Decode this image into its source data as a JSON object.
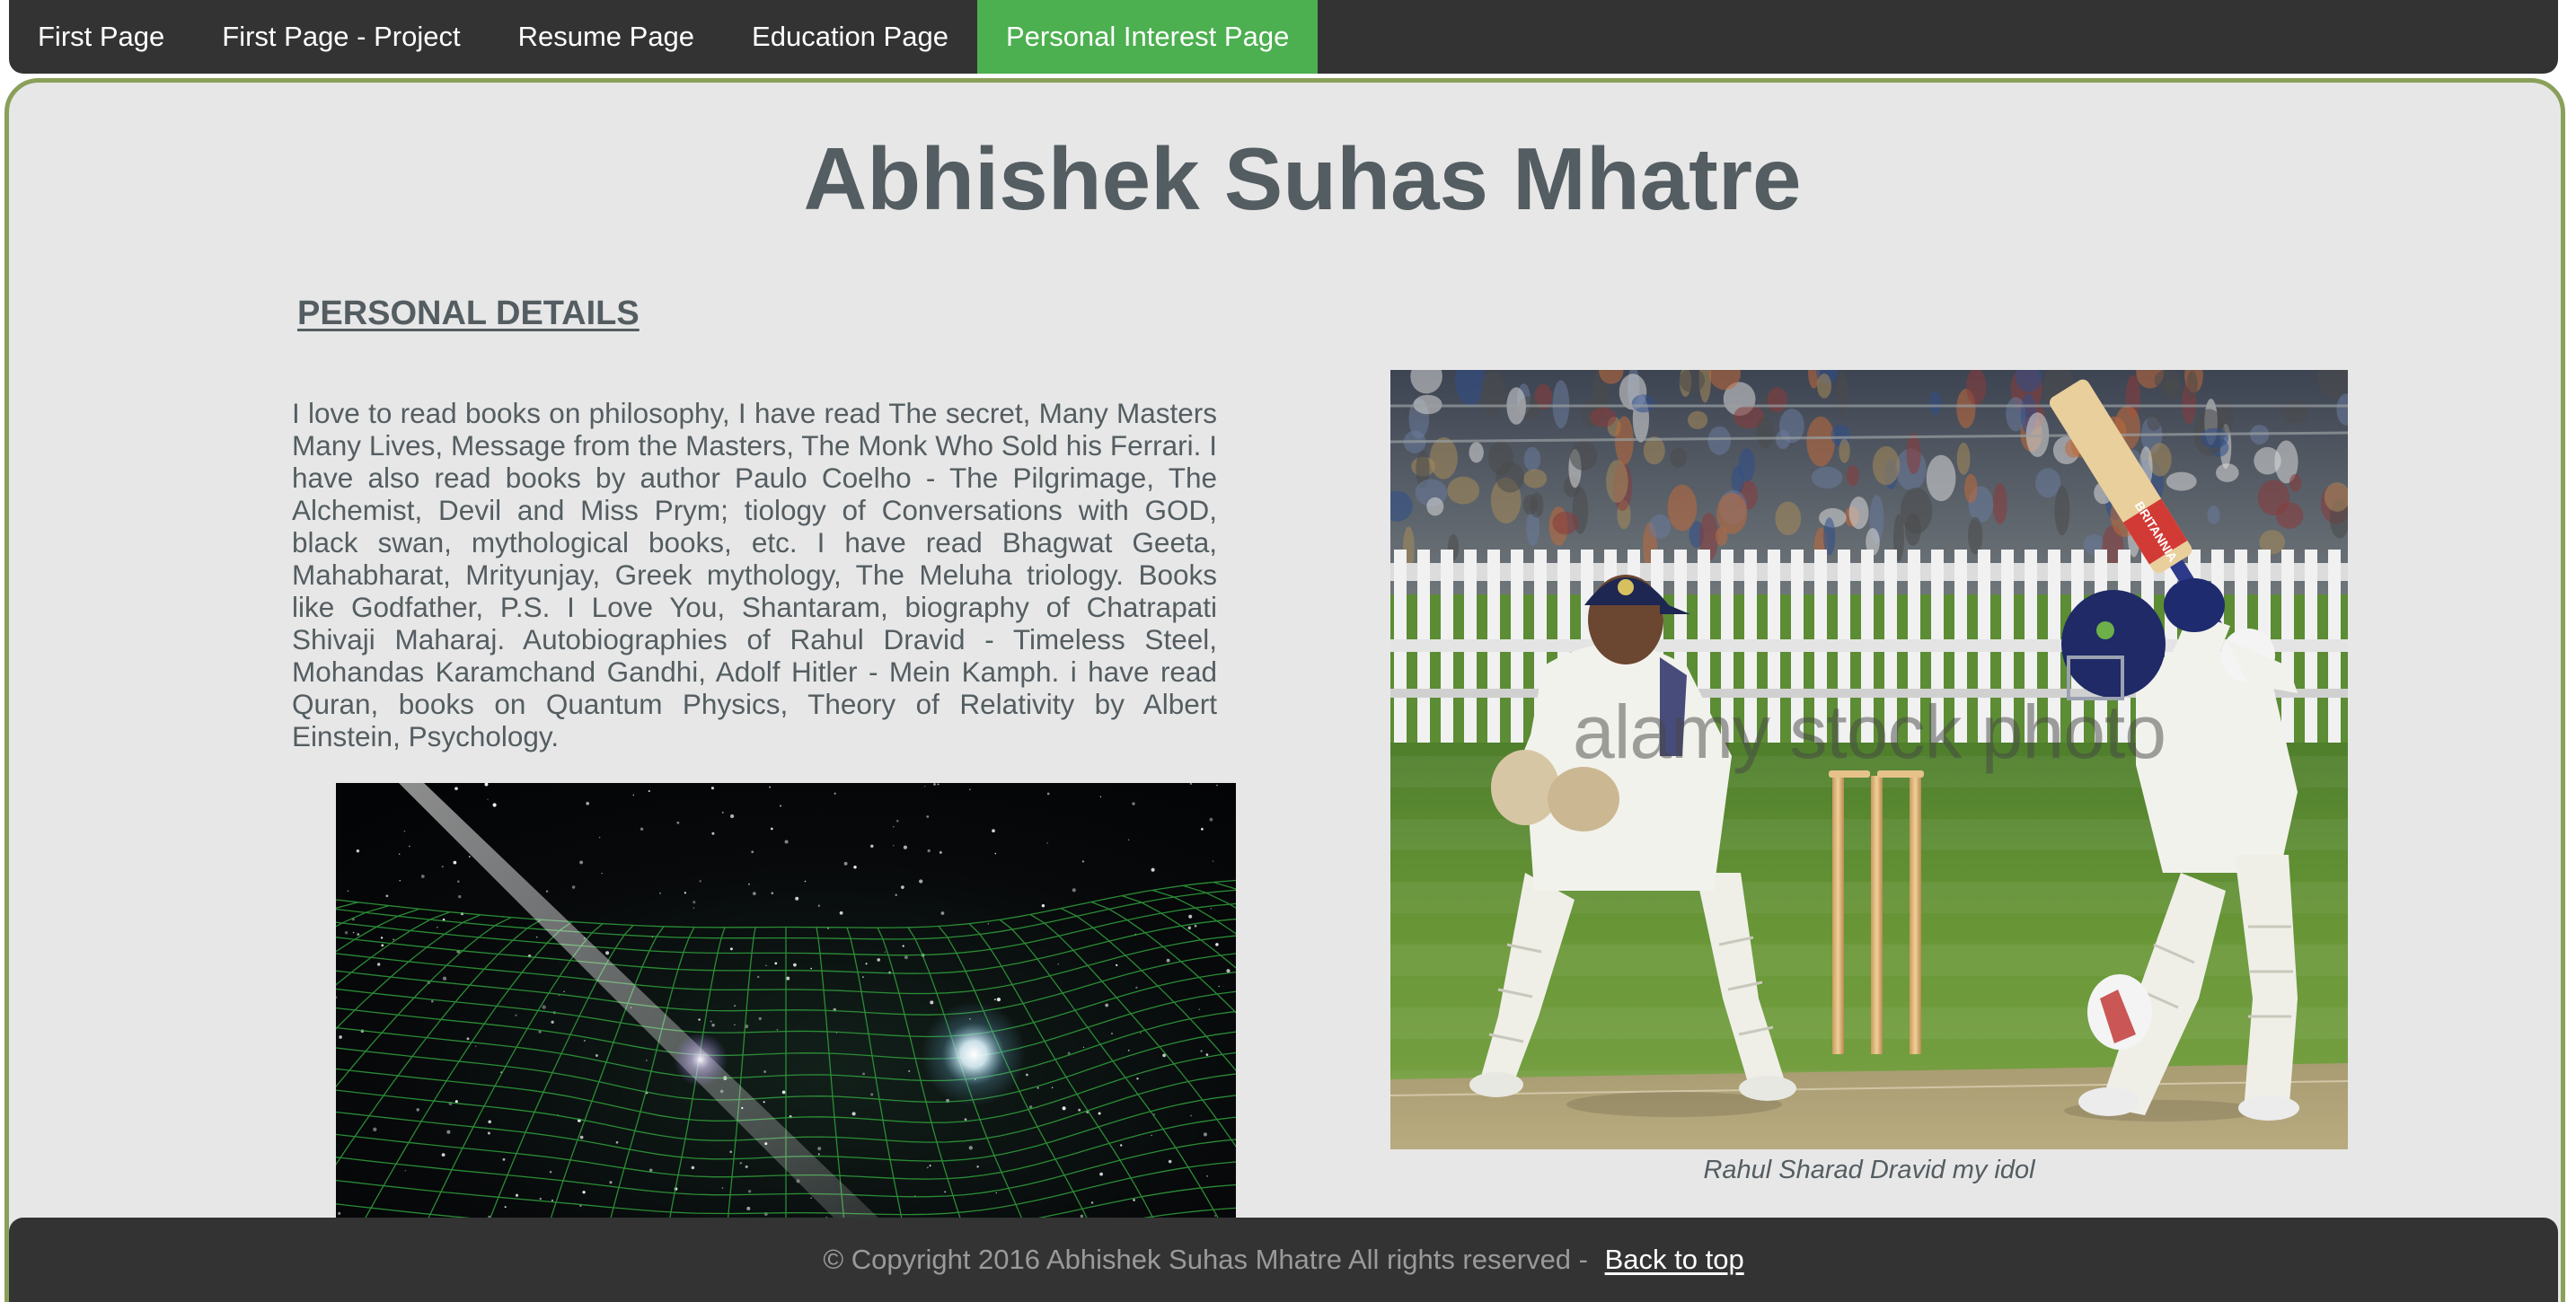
{
  "nav": {
    "items": [
      {
        "label": "First Page",
        "active": false
      },
      {
        "label": "First Page - Project",
        "active": false
      },
      {
        "label": "Resume Page",
        "active": false
      },
      {
        "label": "Education Page",
        "active": false
      },
      {
        "label": "Personal Interest Page",
        "active": true
      }
    ],
    "background_color": "#333333",
    "active_color": "#4CAF50"
  },
  "main": {
    "title": "Abhishek Suhas Mhatre",
    "section_heading": "PERSONAL DETAILS",
    "bio": "I love to read books on philosophy, I have read The secret, Many Masters Many Lives, Message from the Masters, The Monk Who Sold his Ferrari. I have also read books by author Paulo Coelho - The Pilgrimage, The Alchemist, Devil and Miss Prym; tiology of Conversations with GOD, black swan, mythological books, etc. I have read Bhagwat Geeta, Mahabharat, Mrityunjay, Greek mythology, The Meluha triology. Books like Godfather, P.S. I Love You, Shantaram, biography of Chatrapati Shivaji Maharaj. Autobiographies of Rahul Dravid - Timeless Steel, Mohandas Karamchand Gandhi, Adolf Hitler - Mein Kamph. i have read Quran, books on Quantum Physics, Theory of Relativity by Albert Einstein, Psychology.",
    "cricket_image": {
      "watermark": "alamy stock photo",
      "bat_text": "BRITANNIA",
      "caption": "Rahul Sharad Dravid my idol"
    },
    "text_color": "#545d61",
    "panel_border_color": "#8aa05a"
  },
  "footer": {
    "copyright": "© Copyright 2016 Abhishek Suhas Mhatre All rights reserved - ",
    "back_to_top": "Back to top"
  }
}
